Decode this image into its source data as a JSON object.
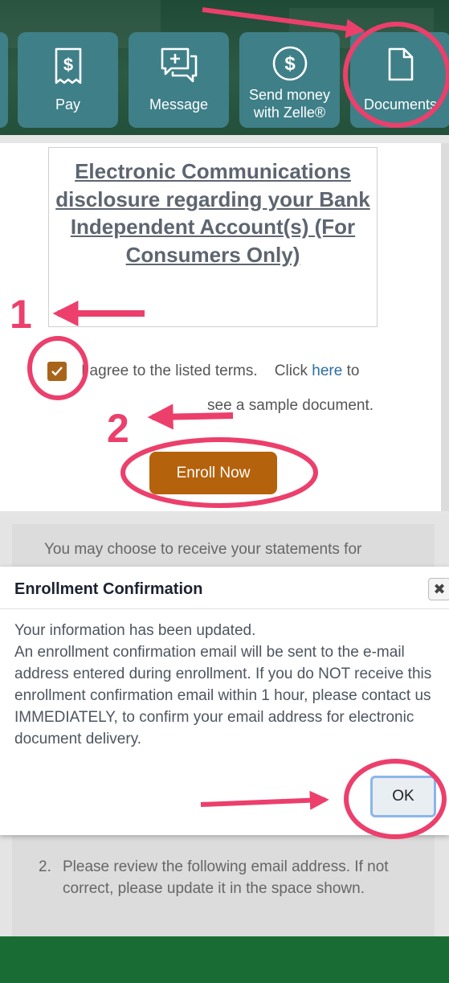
{
  "quick_actions": [
    {
      "label": "Pay",
      "icon": "receipt-dollar-icon"
    },
    {
      "label": "Message",
      "icon": "chat-plus-icon"
    },
    {
      "label": "Send money with Zelle®",
      "icon": "dollar-circle-icon"
    },
    {
      "label": "Documents",
      "icon": "document-icon"
    }
  ],
  "disclosure": {
    "title": "Electronic Communications disclosure regarding your Bank Independent Account(s) (For Consumers Only)"
  },
  "agreement": {
    "checked": true,
    "text": "I agree to the listed terms.",
    "click_label": "Click",
    "link_text": "here",
    "link_suffix": "to",
    "sample_text": "see a sample document."
  },
  "enroll_button": "Enroll Now",
  "statements_text": "You may choose to receive your statements for",
  "step2": {
    "number": "2.",
    "text": "Please review the following email address. If not correct, please update it in the space shown."
  },
  "modal": {
    "title": "Enrollment Confirmation",
    "line1": "Your information has been updated.",
    "line2": "An enrollment confirmation email will be sent to the e-mail address entered during enrollment. If you do NOT receive this enrollment confirmation email within 1 hour, please contact us IMMEDIATELY, to confirm your email address for electronic document delivery.",
    "ok_label": "OK"
  },
  "annotations": {
    "step_1": "1",
    "step_2": "2",
    "color": "#ec3f6c"
  },
  "colors": {
    "header_bg": "#2d5a44",
    "quick_action_bg": "#3f7f88",
    "enroll_button": "#b5620c",
    "footer": "#1a6c35",
    "link": "#2a6ea0"
  }
}
